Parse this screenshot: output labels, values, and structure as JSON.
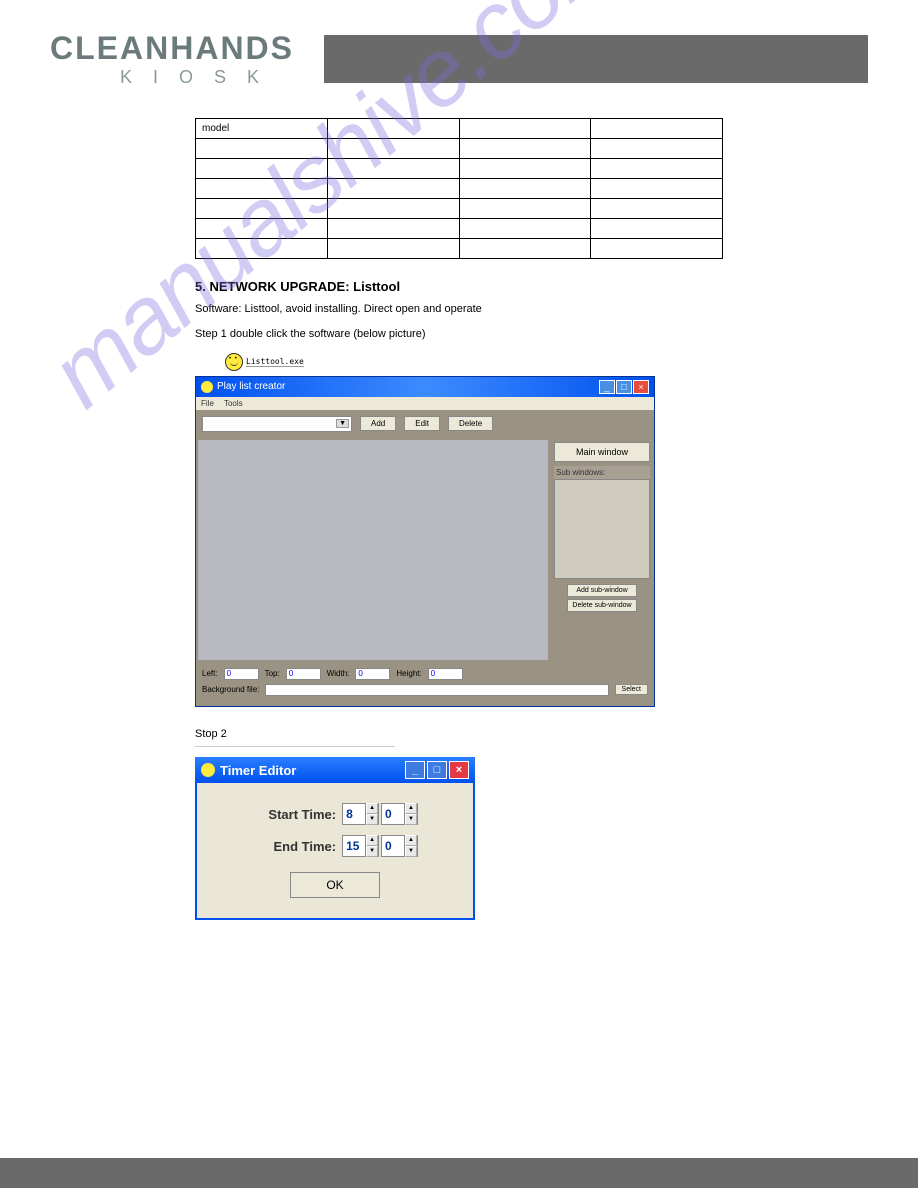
{
  "watermark": "manualshive.com",
  "logo": {
    "main": "CLEANHANDS",
    "sub": "K I O S K"
  },
  "table": {
    "rows": [
      [
        "model",
        "",
        "",
        ""
      ],
      [
        "",
        "",
        "",
        ""
      ],
      [
        "",
        "",
        "",
        ""
      ],
      [
        "",
        "",
        "",
        ""
      ],
      [
        "",
        "",
        "",
        ""
      ],
      [
        "",
        "",
        "",
        ""
      ],
      [
        "",
        "",
        "",
        ""
      ]
    ]
  },
  "section1_title": "5. NETWORK UPGRADE: Listtool",
  "section1_para": "Software: Listtool, avoid installing. Direct open and operate",
  "step_label": "Step 1 double click the software (below picture)",
  "exe_name": "Listtool.exe",
  "playlist": {
    "title": "Play list creator",
    "menu": {
      "file": "File",
      "tools": "Tools"
    },
    "buttons": {
      "add": "Add",
      "edit": "Edit",
      "delete": "Delete"
    },
    "side": {
      "main": "Main window",
      "sub_label": "Sub windows:",
      "add_sub": "Add sub-window",
      "del_sub": "Delete sub-window"
    },
    "fields": {
      "left": "Left:",
      "top": "Top:",
      "width": "Width:",
      "height": "Height:",
      "bg": "Background file:",
      "select": "Select"
    },
    "values": {
      "left": "0",
      "top": "0",
      "width": "0",
      "height": "0"
    }
  },
  "step2": "Stop 2",
  "timer": {
    "title": "Timer Editor",
    "start": "Start Time:",
    "end": "End Time:",
    "ok": "OK",
    "start_h": "8",
    "start_m": "0",
    "end_h": "15",
    "end_m": "0"
  }
}
